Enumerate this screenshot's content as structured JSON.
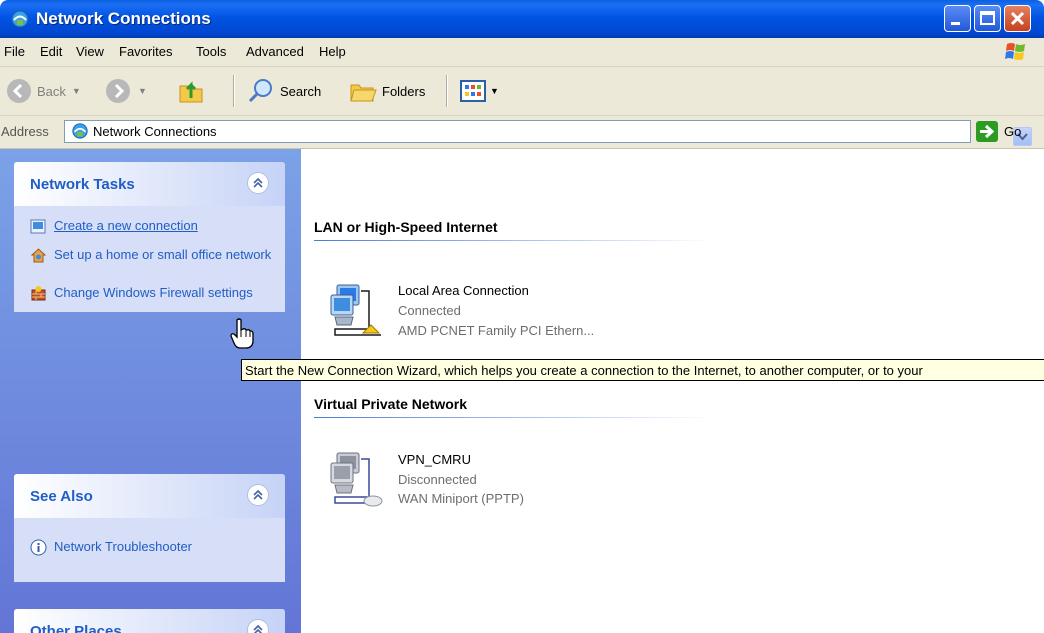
{
  "window": {
    "title": "Network Connections"
  },
  "menu": [
    "File",
    "Edit",
    "View",
    "Favorites",
    "Tools",
    "Advanced",
    "Help"
  ],
  "toolbar": {
    "back": "Back",
    "search": "Search",
    "folders": "Folders"
  },
  "address": {
    "label": "Address",
    "value": "Network Connections",
    "go": "Go"
  },
  "panes": {
    "network_tasks": {
      "title": "Network Tasks",
      "items": [
        {
          "label": "Create a new connection",
          "icon": "new-connection-icon"
        },
        {
          "label": "Set up a home or small office network",
          "icon": "home-network-icon"
        },
        {
          "label": "Change Windows Firewall settings",
          "icon": "firewall-icon"
        }
      ]
    },
    "see_also": {
      "title": "See Also",
      "items": [
        {
          "label": "Network Troubleshooter",
          "icon": "info-icon"
        }
      ]
    },
    "other_places": {
      "title": "Other Places"
    }
  },
  "groups": [
    {
      "title": "LAN or High-Speed Internet",
      "connections": [
        {
          "name": "Local Area Connection",
          "status": "Connected",
          "device": "AMD PCNET Family PCI Ethern..."
        }
      ]
    },
    {
      "title": "Virtual Private Network",
      "connections": [
        {
          "name": "VPN_CMRU",
          "status": "Disconnected",
          "device": "WAN Miniport (PPTP)"
        }
      ]
    }
  ],
  "tooltip": "Start the New Connection Wizard, which helps you create a connection to the Internet, to another computer, or to your",
  "colors": {
    "titlebar": "#0054e3",
    "taskpane": "#6375d6",
    "link": "#215dc6",
    "tooltip_bg": "#ffffe1"
  }
}
